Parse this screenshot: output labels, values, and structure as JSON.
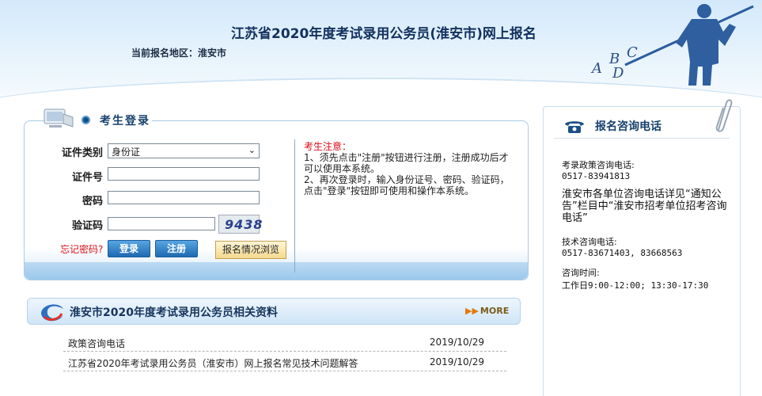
{
  "header": {
    "title": "江苏省2020年度考试录用公务员(淮安市)网上报名",
    "region_label": "当前报名地区：",
    "region_value": "淮安市",
    "deco_letters": [
      "A",
      "B",
      "C",
      "D"
    ]
  },
  "login": {
    "title": "考生登录",
    "id_type_label": "证件类别",
    "id_type_value": "身份证",
    "id_number_label": "证件号",
    "id_number_value": "",
    "password_label": "密码",
    "password_value": "",
    "captcha_label": "验证码",
    "captcha_value": "",
    "captcha_image_text": "9438",
    "forgot_password": "忘记密码?",
    "login_button": "登录",
    "register_button": "注册",
    "browse_button": "报名情况浏览"
  },
  "notice": {
    "title": "考生注意：",
    "item1": "1、须先点击\"注册\"按钮进行注册，注册成功后才可以使用本系统。",
    "item2": "2、再次登录时，输入身份证号、密码、验证码，点击\"登录\"按钮即可使用和操作本系统。"
  },
  "resources": {
    "title": "淮安市2020年度考试录用公务员相关资料",
    "more": "MORE",
    "items": [
      {
        "title": "政策咨询电话",
        "date": "2019/10/29"
      },
      {
        "title": "江苏省2020年考试录用公务员（淮安市）网上报名常见技术问题解答",
        "date": "2019/10/29"
      }
    ]
  },
  "consult": {
    "title": "报名咨询电话",
    "policy_label": "考录政策咨询电话:",
    "policy_phone": "0517-83941813",
    "units_note": "淮安市各单位咨询电话详见“通知公告”栏目中“淮安市招考单位招考咨询电话”",
    "tech_label": "技术咨询电话:",
    "tech_phone": "0517-83671403, 83668563",
    "hours_label": "咨询时间:",
    "hours_value": "工作日9:00-12:00; 13:30-17:30"
  },
  "colors": {
    "accent_blue": "#1f6ab2",
    "notice_red": "#d6101a",
    "title_navy": "#12315e"
  }
}
